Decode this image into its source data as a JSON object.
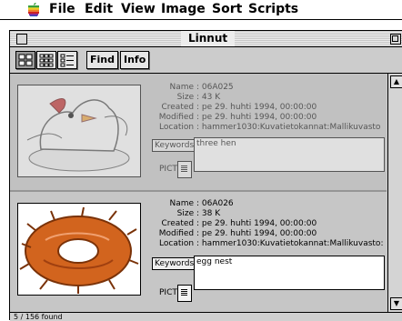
{
  "menubar": {
    "apple_icon": "apple-icon",
    "items": [
      "File",
      "Edit",
      "View",
      "Image",
      "Sort",
      "Scripts"
    ]
  },
  "window": {
    "title": "Linnut"
  },
  "toolbar": {
    "find_label": "Find",
    "info_label": "Info",
    "view_icons": [
      "large-icons-view-icon",
      "small-icons-view-icon",
      "list-view-icon"
    ]
  },
  "records": [
    {
      "name_label": "Name :",
      "name": "06A025",
      "size_label": "Size :",
      "size": "43 K",
      "created_label": "Created :",
      "created": "pe 29. huhti 1994, 00:00:00",
      "modified_label": "Modified :",
      "modified": "pe 29. huhti 1994, 00:00:00",
      "location_label": "Location :",
      "location": "hammer1030:Kuvatietokannat:Mallikuvasto",
      "keywords_label": "Keywords",
      "keywords": "three hen",
      "pict_label": "PICT",
      "image": "chicken-cartoon-image"
    },
    {
      "name_label": "Name :",
      "name": "06A026",
      "size_label": "Size :",
      "size": "38 K",
      "created_label": "Created :",
      "created": "pe 29. huhti 1994, 00:00:00",
      "modified_label": "Modified :",
      "modified": "pe 29. huhti 1994, 00:00:00",
      "location_label": "Location :",
      "location": "hammer1030:Kuvatietokannat:Mallikuvasto:",
      "keywords_label": "Keywords",
      "keywords": "egg nest",
      "pict_label": "PICT",
      "image": "bird-nest-image"
    }
  ],
  "status": {
    "text": "5 / 156 found"
  },
  "colors": {
    "window_bg": "#cccccc",
    "nest_orange": "#d2641e",
    "chick_red": "#c02020"
  }
}
